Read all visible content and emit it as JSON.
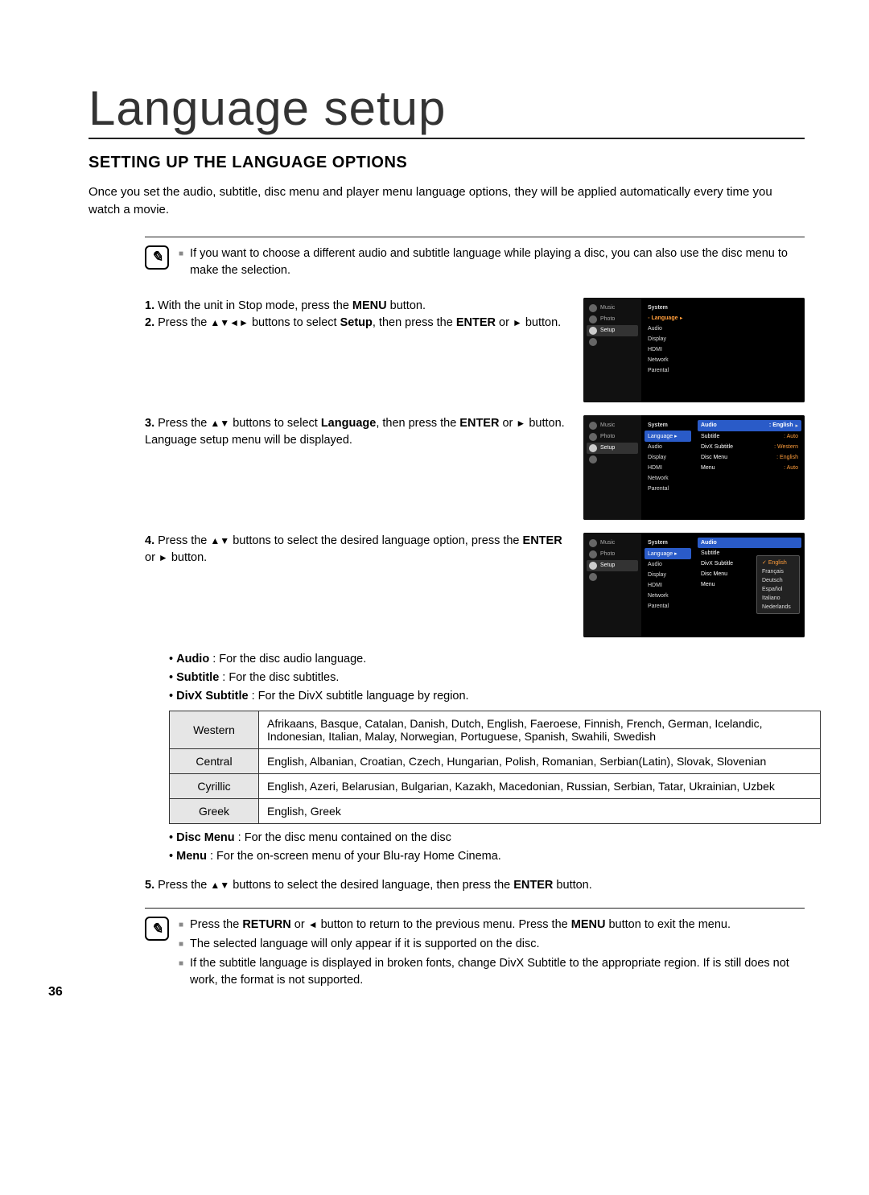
{
  "title": "Language setup",
  "section_heading": "SETTING UP THE LANGUAGE OPTIONS",
  "intro": "Once you set the audio, subtitle, disc menu and player menu language options, they will be applied automatically every time you watch a movie.",
  "note_top": "If you want to choose a different audio and subtitle language while playing a disc, you can also use the disc menu to make the selection.",
  "steps": {
    "s1": {
      "num": "1.",
      "pre": "With the unit in Stop mode, press the ",
      "bold": "MENU",
      "post": " button."
    },
    "s2": {
      "num": "2.",
      "pre": "Press the ",
      "arrows": "▲▼◄►",
      "mid": " buttons to select ",
      "bold": "Setup",
      "post1": ", then press the ",
      "bold2": "ENTER",
      "post2": " or ",
      "glyph": "►",
      "post3": " button."
    },
    "s3": {
      "num": "3.",
      "pre": "Press the ",
      "arrows": "▲▼",
      "mid": " buttons to select ",
      "bold": "Language",
      "post1": ", then press the ",
      "bold2": "ENTER",
      "post2": " or ",
      "glyph": "►",
      "post3": " button.",
      "line2": "Language setup menu will be displayed."
    },
    "s4": {
      "num": "4.",
      "pre": "Press the ",
      "arrows": "▲▼",
      "mid": " buttons to select the desired language option, press the ",
      "bold": "ENTER",
      "post1": " or ",
      "glyph": "►",
      "post2": " button."
    },
    "s5": {
      "num": "5.",
      "pre": "Press the ",
      "arrows": "▲▼",
      "mid": " buttons to select the desired language, then press the ",
      "bold": "ENTER",
      "post": " button."
    }
  },
  "bullets_top": {
    "audio": {
      "label": "Audio",
      "desc": " : For the disc audio language."
    },
    "subtitle": {
      "label": "Subtitle",
      "desc": " : For the disc subtitles."
    },
    "divx": {
      "label": "DivX Subtitle",
      "desc": " : For the DivX subtitle language by region."
    }
  },
  "divx_table": [
    {
      "region": "Western",
      "langs": "Afrikaans, Basque, Catalan, Danish, Dutch, English, Faeroese, Finnish, French, German, Icelandic, Indonesian, Italian, Malay, Norwegian, Portuguese, Spanish, Swahili, Swedish"
    },
    {
      "region": "Central",
      "langs": "English, Albanian, Croatian, Czech, Hungarian, Polish, Romanian, Serbian(Latin), Slovak, Slovenian"
    },
    {
      "region": "Cyrillic",
      "langs": "English, Azeri, Belarusian, Bulgarian, Kazakh, Macedonian, Russian, Serbian, Tatar, Ukrainian, Uzbek"
    },
    {
      "region": "Greek",
      "langs": "English, Greek"
    }
  ],
  "bullets_bottom": {
    "discmenu": {
      "label": "Disc Menu",
      "desc": " : For the disc menu contained on the disc"
    },
    "menu": {
      "label": "Menu",
      "desc": " : For the on-screen menu of your Blu-ray Home Cinema."
    }
  },
  "note_bottom": {
    "n1a": "Press the ",
    "n1b": "RETURN",
    "n1c": " or ",
    "n1arrow": "◄",
    "n1d": " button to return to the previous menu. Press the ",
    "n1e": "MENU",
    "n1f": " button to exit the menu.",
    "n2": "The selected language will only appear if it is supported on the disc.",
    "n3": "If the subtitle language is displayed in broken fonts, change DivX Subtitle to the appropriate region. If is still does not work, the format is not supported."
  },
  "osd": {
    "left": {
      "music": "Music",
      "photo": "Photo",
      "setup": "Setup"
    },
    "menu1": {
      "system": "System",
      "language": "Language",
      "audio": "Audio",
      "display": "Display",
      "hdmi": "HDMI",
      "network": "Network",
      "parental": "Parental"
    },
    "right2": {
      "audio": {
        "k": "Audio",
        "v": ": English"
      },
      "subtitle": {
        "k": "Subtitle",
        "v": ": Auto"
      },
      "divx": {
        "k": "DivX Subtitle",
        "v": ": Western"
      },
      "discmenu": {
        "k": "Disc Menu",
        "v": ": English"
      },
      "menu": {
        "k": "Menu",
        "v": ": Auto"
      }
    },
    "dropdown3": {
      "english": "English",
      "francais": "Français",
      "deutsch": "Deutsch",
      "espanol": "Español",
      "italiano": "Italiano",
      "nederlands": "Nederlands"
    }
  },
  "page_number": "36",
  "note_icon_glyph": "✎"
}
